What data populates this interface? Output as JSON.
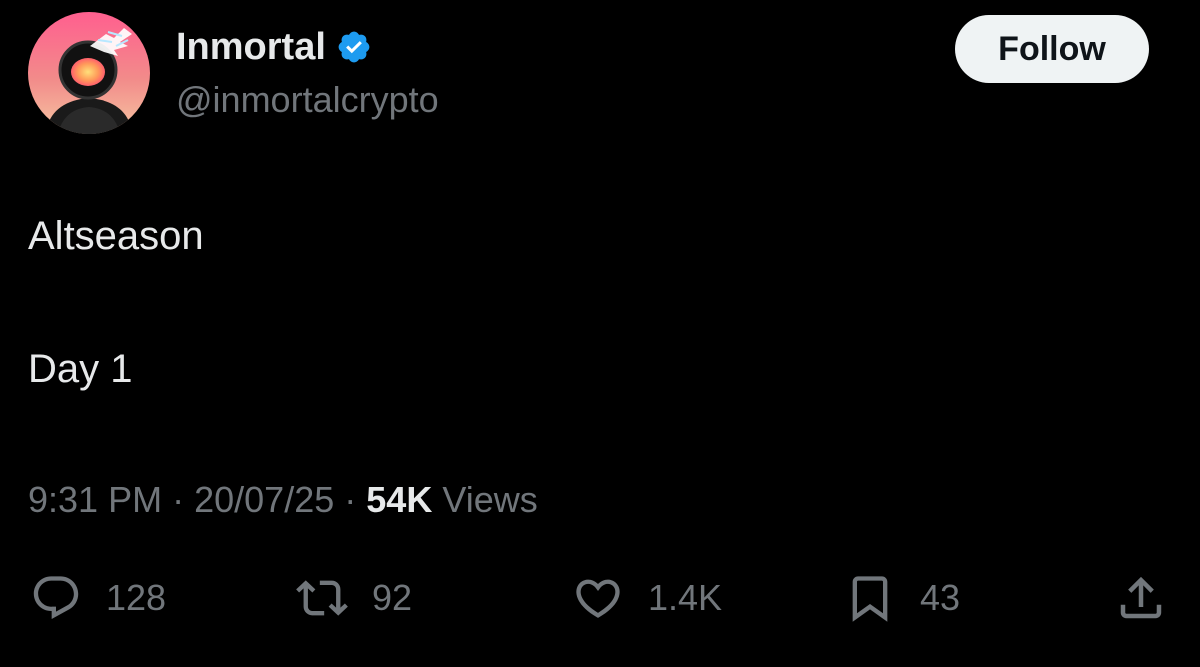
{
  "author": {
    "display_name": "Inmortal",
    "handle": "@inmortalcrypto",
    "verified": true,
    "verified_color": "#1d9bf0",
    "avatar_icon": "astronaut-avatar"
  },
  "follow_button": {
    "label": "Follow"
  },
  "tweet": {
    "lines": [
      "Altseason",
      "Day 1"
    ]
  },
  "meta": {
    "time": "9:31 PM",
    "separator": "·",
    "date": "20/07/25",
    "views_count": "54K",
    "views_label": "Views"
  },
  "actions": {
    "reply": {
      "icon": "reply-icon",
      "count": "128"
    },
    "retweet": {
      "icon": "retweet-icon",
      "count": "92"
    },
    "like": {
      "icon": "heart-icon",
      "count": "1.4K"
    },
    "bookmark": {
      "icon": "bookmark-icon",
      "count": "43"
    },
    "share": {
      "icon": "share-icon"
    }
  },
  "colors": {
    "background": "#000000",
    "primary_text": "#e7e9ea",
    "secondary_text": "#71767b",
    "button_bg": "#eff3f4"
  }
}
